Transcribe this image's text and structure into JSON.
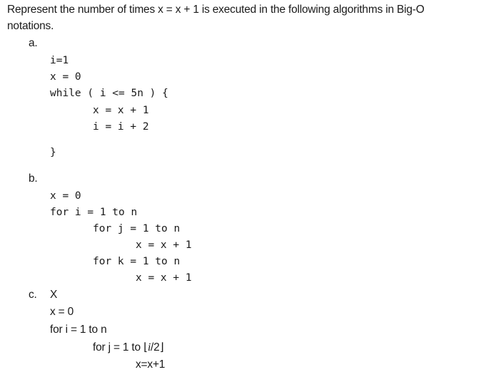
{
  "question": {
    "intro_line1": "Represent the number of times x = x + 1 is executed in the following algorithms in Big-O",
    "intro_line2": "notations."
  },
  "parts": {
    "a": {
      "label": "a.",
      "code": [
        "i=1",
        "x = 0",
        "while ( i <= 5n ) {",
        "x = x + 1",
        "i = i + 2",
        "}"
      ]
    },
    "b": {
      "label": "b.",
      "code": [
        "x = 0",
        "for i = 1 to n",
        "for j = 1 to n",
        "x = x + 1",
        "for k = 1 to n",
        "x = x + 1"
      ]
    },
    "c": {
      "label": "c.",
      "marker": "X",
      "code": [
        "x = 0",
        "for i = 1 to n",
        "for j = 1 to ⌊i/2⌋",
        "x=x+1"
      ],
      "floor_left": "⌊",
      "floor_var": "i",
      "floor_rest": "/2",
      "floor_right": "⌋",
      "inner_loop_prefix": "for j = 1 to "
    }
  }
}
